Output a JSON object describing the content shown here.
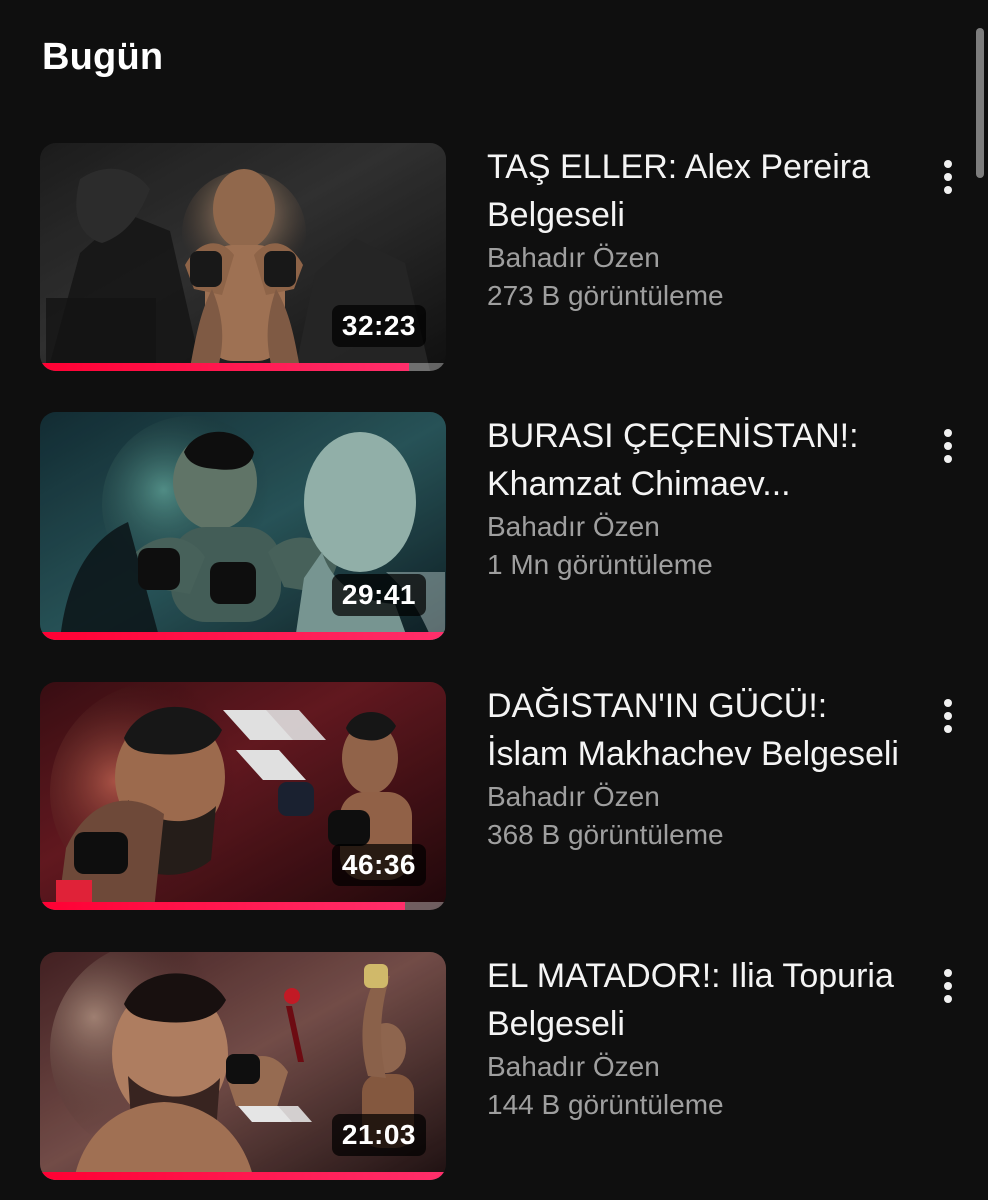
{
  "section": {
    "title": "Bugün"
  },
  "videos": [
    {
      "title": "TAŞ ELLER:  Alex Pereira Belgeseli",
      "channel": "Bahadır Özen",
      "views": "273 B görüntüleme",
      "duration": "32:23",
      "progress": 0.91,
      "thumb_style": "pereira"
    },
    {
      "title": "BURASI ÇEÇENİSTAN!: Khamzat Chimaev...",
      "channel": "Bahadır Özen",
      "views": "1 Mn görüntüleme",
      "duration": "29:41",
      "progress": 1.0,
      "thumb_style": "chimaev"
    },
    {
      "title": "DAĞISTAN'IN GÜCÜ!: İslam Makhachev Belgeseli",
      "channel": "Bahadır Özen",
      "views": "368 B görüntüleme",
      "duration": "46:36",
      "progress": 0.9,
      "thumb_style": "makhachev"
    },
    {
      "title": "EL MATADOR!: Ilia Topuria Belgeseli",
      "channel": "Bahadır Özen",
      "views": "144 B görüntüleme",
      "duration": "21:03",
      "progress": 1.0,
      "thumb_style": "topuria"
    }
  ],
  "icons": {
    "menu": "more-vertical-icon"
  },
  "colors": {
    "background": "#0f0f0f",
    "title": "#f4f4f4",
    "secondary_text": "#9f9f9f",
    "progress": "#ff0033"
  }
}
